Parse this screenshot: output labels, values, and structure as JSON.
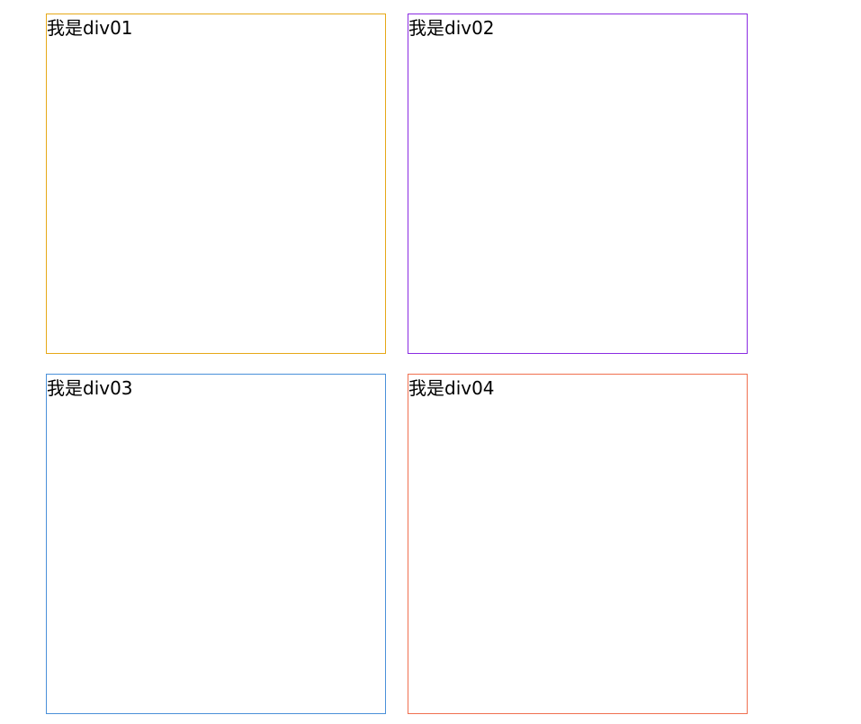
{
  "boxes": [
    {
      "label": "我是div01",
      "border_color": "#e6a817"
    },
    {
      "label": "我是div02",
      "border_color": "#8a2be2"
    },
    {
      "label": "我是div03",
      "border_color": "#4a90d9"
    },
    {
      "label": "我是div04",
      "border_color": "#f07050"
    }
  ]
}
